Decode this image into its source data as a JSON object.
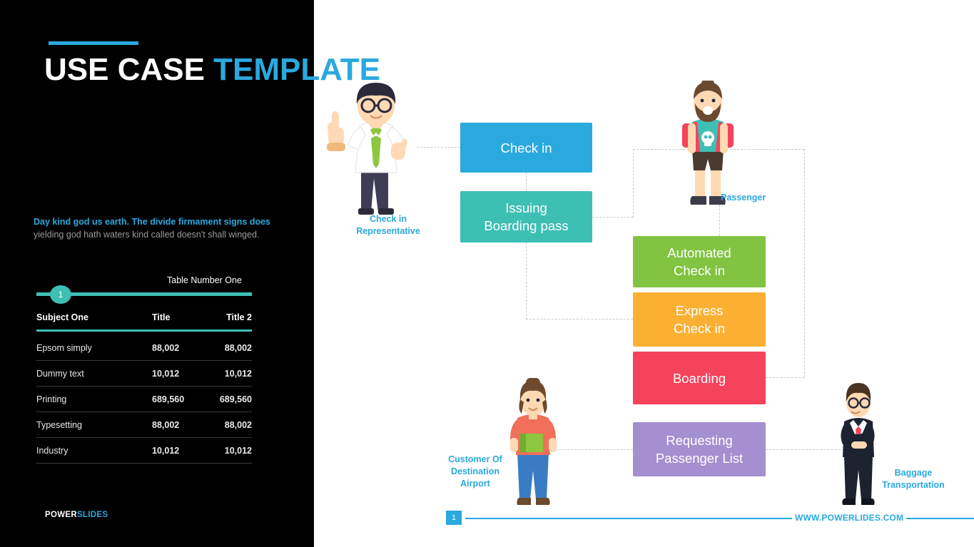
{
  "slide": {
    "title_main": "USE CASE ",
    "title_highlight": "TEMPLATE",
    "body_bold": "Day kind god us earth. The divide firmament signs does",
    "body_rest": " yielding god hath waters kind called doesn't shall winged.",
    "brand_first": "POWER",
    "brand_second": "SLIDES",
    "footer_url": "WWW.POWERLIDES.COM",
    "footer_number": "1"
  },
  "table": {
    "caption": "Table Number One",
    "badge": "1",
    "headers": [
      "Subject One",
      "Title",
      "Title 2"
    ],
    "rows": [
      [
        "Epsom simply",
        "88,002",
        "88,002"
      ],
      [
        "Dummy text",
        "10,012",
        "10,012"
      ],
      [
        "Printing",
        "689,560",
        "689,560"
      ],
      [
        "Typesetting",
        "88,002",
        "88,002"
      ],
      [
        "Industry",
        "10,012",
        "10,012"
      ]
    ]
  },
  "diagram": {
    "boxes": [
      {
        "id": "checkin",
        "label": "Check in",
        "color": "#2aa9df"
      },
      {
        "id": "issuing",
        "label": "Issuing\nBoarding pass",
        "line1": "Issuing",
        "line2": "Boarding pass",
        "color": "#3ebfb4"
      },
      {
        "id": "automated",
        "line1": "Automated",
        "line2": "Check in",
        "color": "#82c341"
      },
      {
        "id": "express",
        "line1": "Express",
        "line2": "Check in",
        "color": "#fbb034"
      },
      {
        "id": "boarding",
        "label": "Boarding",
        "color": "#f5435c"
      },
      {
        "id": "requesting",
        "line1": "Requesting",
        "line2": "Passenger List",
        "color": "#a48fd0"
      }
    ],
    "actors": [
      {
        "id": "check-in-representative",
        "line1": "Check in",
        "line2": "Representative"
      },
      {
        "id": "passenger",
        "line1": "Passenger",
        "line2": ""
      },
      {
        "id": "customer-of-destination-airport",
        "line1": "Customer Of",
        "line2": "Destination",
        "line3": "Airport"
      },
      {
        "id": "baggage-transportation",
        "line1": "Baggage",
        "line2": "Transportation"
      }
    ]
  },
  "colors": {
    "accent_blue": "#2aa9df",
    "teal": "#3ebfb4",
    "green": "#82c341",
    "orange": "#fbb034",
    "red": "#f5435c",
    "purple": "#a48fd0",
    "panel_black": "#000000"
  }
}
